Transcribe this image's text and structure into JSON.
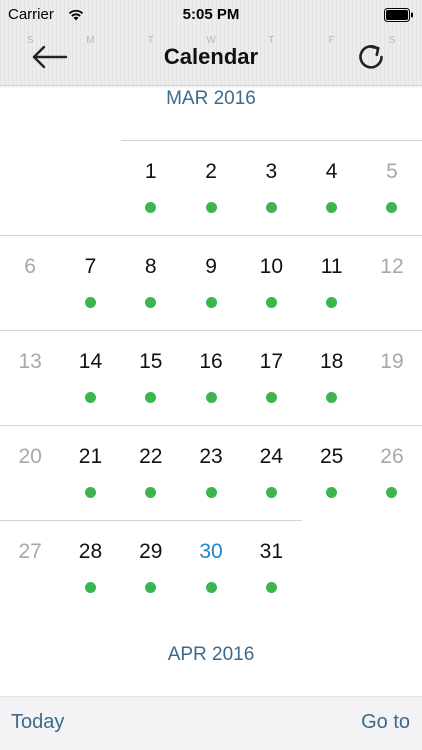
{
  "status_bar": {
    "carrier": "Carrier",
    "time": "5:05 PM"
  },
  "nav": {
    "title": "Calendar",
    "back_icon": "arrow-left-icon",
    "refresh_icon": "refresh-icon"
  },
  "ghost_weekdays": [
    "S",
    "M",
    "T",
    "W",
    "T",
    "F",
    "S"
  ],
  "months": [
    {
      "title": "MAR 2016",
      "weeks": [
        [
          null,
          null,
          {
            "d": "1",
            "dot": true
          },
          {
            "d": "2",
            "dot": true
          },
          {
            "d": "3",
            "dot": true
          },
          {
            "d": "4",
            "dot": true
          },
          {
            "d": "5",
            "dot": true,
            "weekend": true
          }
        ],
        [
          {
            "d": "6",
            "weekend": true
          },
          {
            "d": "7",
            "dot": true
          },
          {
            "d": "8",
            "dot": true
          },
          {
            "d": "9",
            "dot": true
          },
          {
            "d": "10",
            "dot": true
          },
          {
            "d": "11",
            "dot": true
          },
          {
            "d": "12",
            "weekend": true
          }
        ],
        [
          {
            "d": "13",
            "weekend": true
          },
          {
            "d": "14",
            "dot": true
          },
          {
            "d": "15",
            "dot": true
          },
          {
            "d": "16",
            "dot": true
          },
          {
            "d": "17",
            "dot": true
          },
          {
            "d": "18",
            "dot": true
          },
          {
            "d": "19",
            "weekend": true
          }
        ],
        [
          {
            "d": "20",
            "weekend": true
          },
          {
            "d": "21",
            "dot": true
          },
          {
            "d": "22",
            "dot": true
          },
          {
            "d": "23",
            "dot": true
          },
          {
            "d": "24",
            "dot": true
          },
          {
            "d": "25",
            "dot": true
          },
          {
            "d": "26",
            "dot": true,
            "weekend": true
          }
        ],
        [
          {
            "d": "27",
            "weekend": true
          },
          {
            "d": "28",
            "dot": true
          },
          {
            "d": "29",
            "dot": true
          },
          {
            "d": "30",
            "dot": true,
            "today": true
          },
          {
            "d": "31",
            "dot": true
          },
          null,
          null
        ]
      ]
    },
    {
      "title": "APR 2016"
    }
  ],
  "toolbar": {
    "today_label": "Today",
    "goto_label": "Go to"
  },
  "colors": {
    "accent": "#3c6a8c",
    "today": "#1f86c9",
    "event_dot": "#3cb54e",
    "weekend_text": "#a8a8a8"
  }
}
